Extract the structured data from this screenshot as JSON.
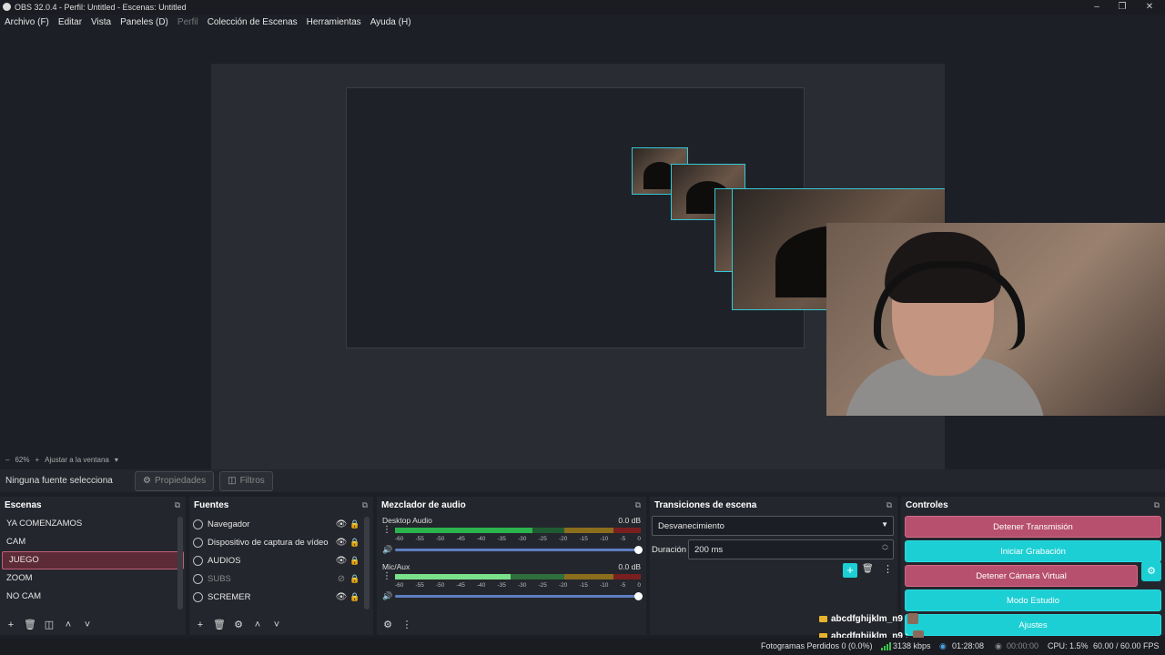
{
  "window": {
    "title": "OBS 32.0.4 - Perfil: Untitled - Escenas: Untitled"
  },
  "menu": [
    "Archivo (F)",
    "Editar",
    "Vista",
    "Paneles (D)",
    "Perfil",
    "Colección de Escenas",
    "Herramientas",
    "Ayuda (H)"
  ],
  "zoom": {
    "percent": "62%",
    "fit_label": "Ajustar a la ventana"
  },
  "properties_bar": {
    "no_source": "Ninguna fuente selecciona",
    "properties": "Propiedades",
    "filters": "Filtros"
  },
  "scenes": {
    "title": "Escenas",
    "items": [
      "YA COMENZAMOS",
      "CAM",
      "JUEGO",
      "ZOOM",
      "NO CAM"
    ],
    "selected": "JUEGO"
  },
  "sources": {
    "title": "Fuentes",
    "items": [
      {
        "name": "Navegador",
        "visible": true
      },
      {
        "name": "Dispositivo de captura de vídeo",
        "visible": true
      },
      {
        "name": "AUDIOS",
        "visible": true
      },
      {
        "name": "SUBS",
        "visible": false
      },
      {
        "name": "SCREMER",
        "visible": true
      }
    ]
  },
  "mixer": {
    "title": "Mezclador de audio",
    "channels": [
      {
        "name": "Desktop Audio",
        "db": "0.0 dB",
        "level": 0.56
      },
      {
        "name": "Mic/Aux",
        "db": "0.0 dB",
        "level": 0.47
      }
    ],
    "ticks": [
      "-60",
      "-55",
      "-50",
      "-45",
      "-40",
      "-35",
      "-30",
      "-25",
      "-20",
      "-15",
      "-10",
      "-5",
      "0"
    ]
  },
  "transitions": {
    "title": "Transiciones de escena",
    "selected": "Desvanecimiento",
    "duration_label": "Duración",
    "duration_value": "200 ms"
  },
  "controls": {
    "title": "Controles",
    "stop_stream": "Detener Transmisión",
    "start_record": "Iniciar Grabación",
    "stop_vcam": "Detener Cámara Virtual",
    "studio_mode": "Modo Estudio",
    "settings": "Ajustes"
  },
  "chat": [
    "abcdfghijklm_n9",
    "abcdfghijklm_n9 :"
  ],
  "status": {
    "dropped_frames": "Fotogramas Perdidos 0 (0.0%)",
    "bitrate": "3138 kbps",
    "stream_time": "01:28:08",
    "record_time": "00:00:00",
    "cpu": "CPU: 1.5%",
    "fps": "60.00 / 60.00 FPS"
  },
  "colors": {
    "accent_cyan": "#1ccfd4",
    "accent_stop": "#b74f6e",
    "selection": "#5d2a37",
    "background": "#1d1f26"
  }
}
